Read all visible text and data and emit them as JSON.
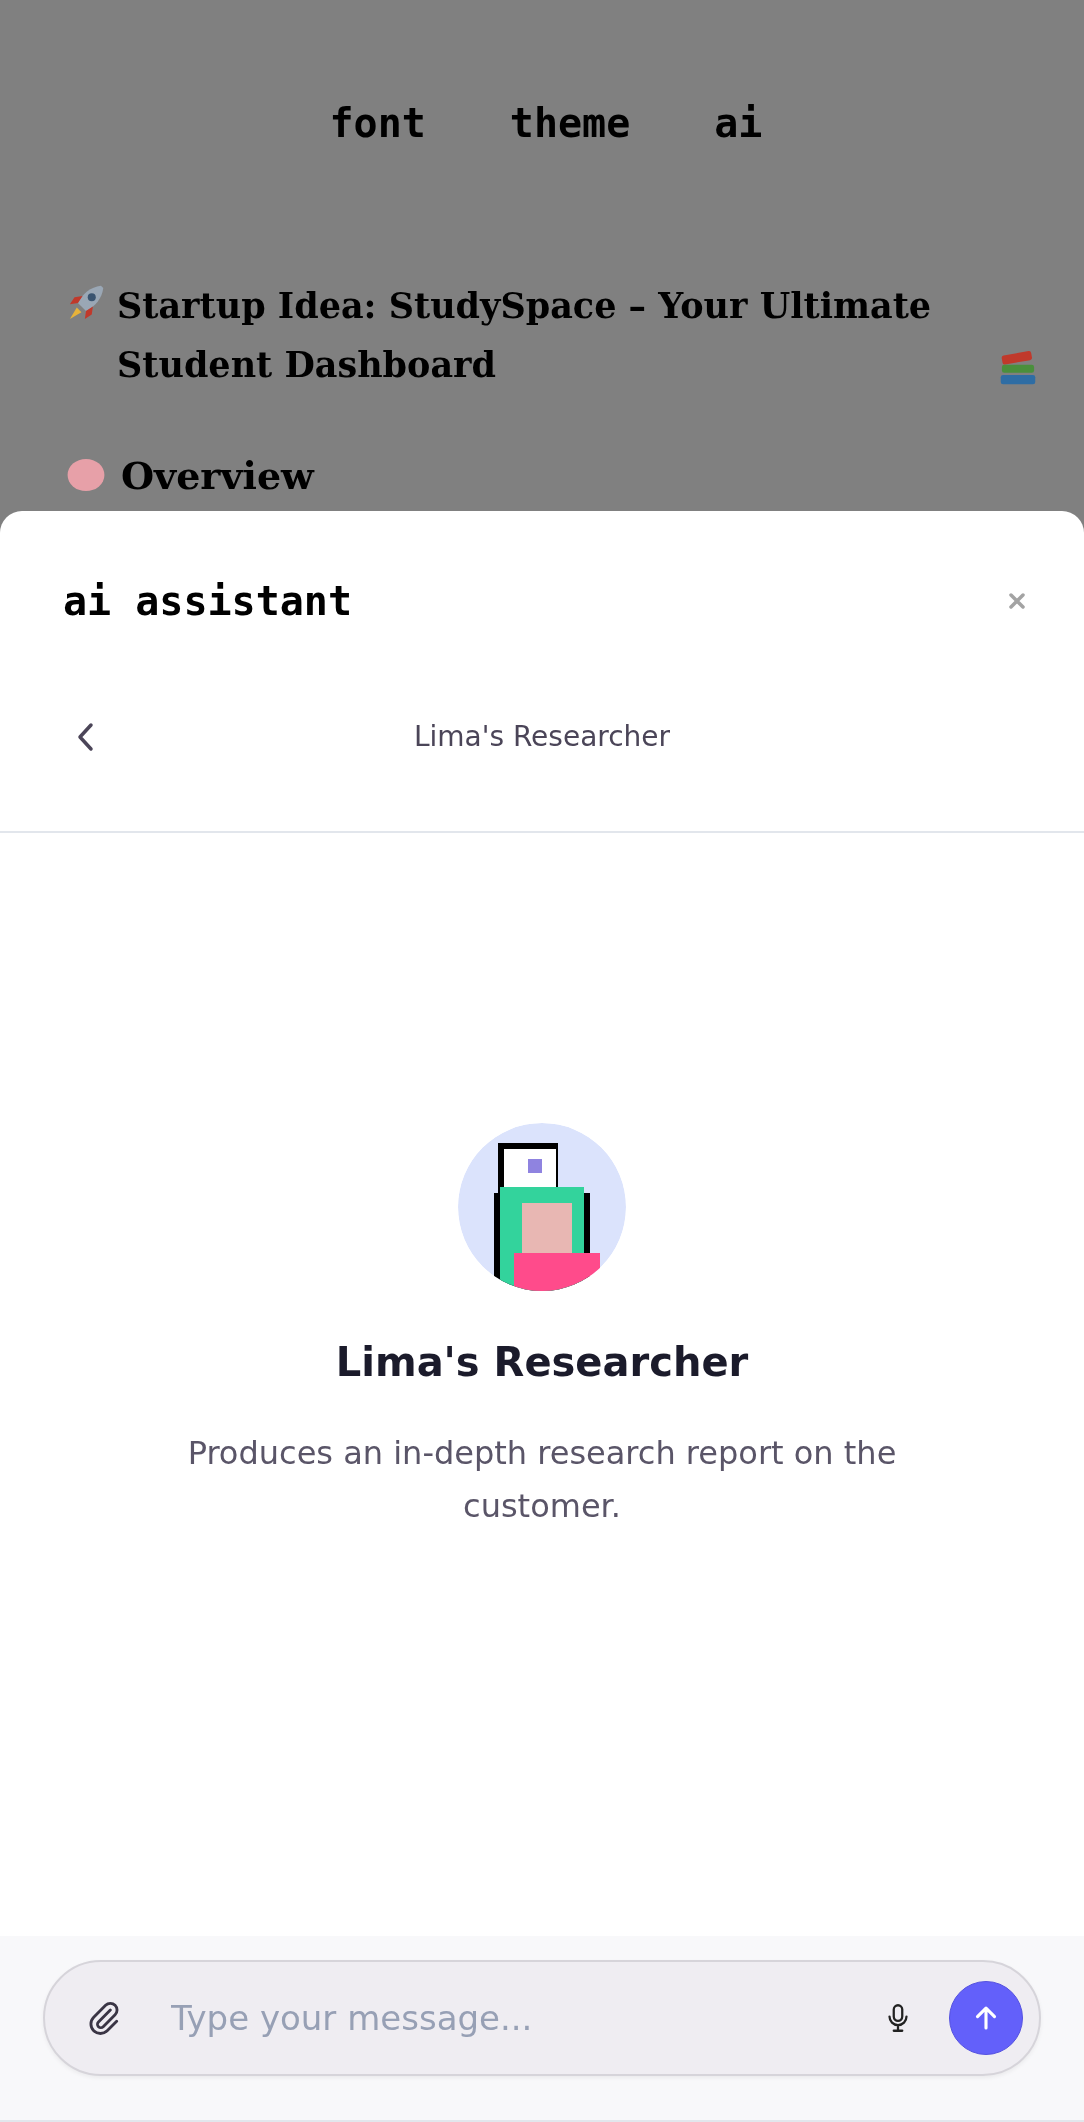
{
  "nav": [
    "font",
    "theme",
    "ai"
  ],
  "document": {
    "heading": "Startup Idea: StudySpace – Your Ultimate Student Dashboard",
    "subheading": "Overview"
  },
  "panel": {
    "title": "ai assistant",
    "agent_bar": {
      "title": "Lima's Researcher"
    },
    "agent": {
      "name": "Lima's Researcher",
      "description": "Produces an in-depth research report on the customer."
    },
    "composer": {
      "placeholder": "Type your message..."
    }
  }
}
